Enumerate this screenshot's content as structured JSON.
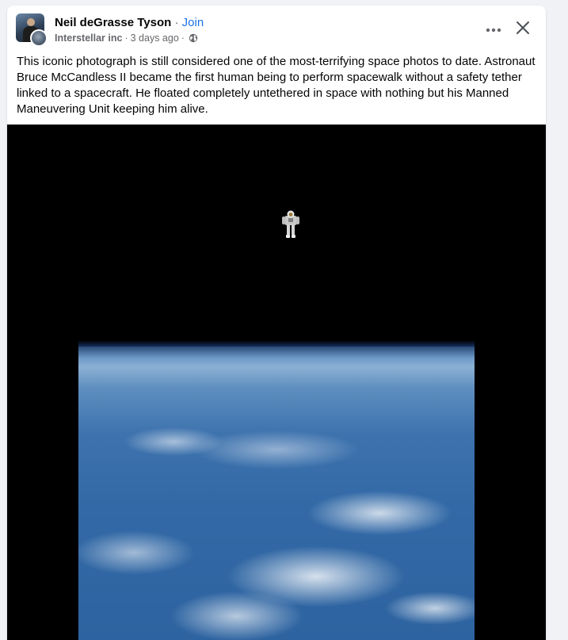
{
  "post": {
    "author": "Neil deGrasse Tyson",
    "separator": " · ",
    "join_label": "Join",
    "group": "Interstellar inc",
    "time": "3 days ago",
    "meta_separator": "·",
    "text": "This iconic photograph is still considered one of the most-terrifying space photos to date. Astronaut Bruce McCandless II became the first human being to perform spacewalk without a safety tether linked to a spacecraft. He floated completely untethered in space with nothing but his Manned Maneuvering Unit keeping him alive."
  },
  "icons": {
    "more": "more-horizontal-icon",
    "close": "close-icon",
    "privacy": "globe-icon"
  },
  "colors": {
    "link": "#1b74e4",
    "text": "#050505",
    "secondary": "#65676b",
    "media_background": "#000000"
  }
}
